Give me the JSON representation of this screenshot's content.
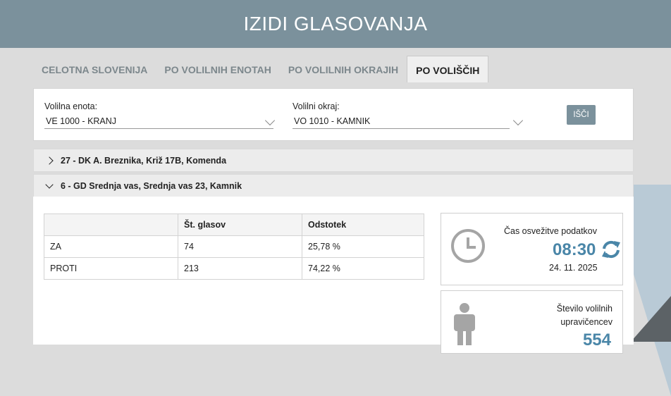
{
  "header": {
    "title": "IZIDI GLASOVANJA"
  },
  "tabs": [
    {
      "label": "CELOTNA SLOVENIJA"
    },
    {
      "label": "PO VOLILNIH ENOTAH"
    },
    {
      "label": "PO VOLILNIH OKRAJIH"
    },
    {
      "label": "PO VOLIŠČIH",
      "active": true
    }
  ],
  "filter": {
    "enota_label": "Volilna enota:",
    "enota_value": "VE 1000 - KRANJ",
    "okraj_label": "Volilni okraj:",
    "okraj_value": "VO 1010 - KAMNIK",
    "search_label": "IŠČI"
  },
  "stations": [
    {
      "title": "27 - DK A. Breznika, Križ 17B, Komenda",
      "expanded": false
    },
    {
      "title": "6 - GD Srednja vas, Srednja vas 23, Kamnik",
      "expanded": true
    }
  ],
  "results": {
    "headers": [
      "",
      "Št. glasov",
      "Odstotek"
    ],
    "rows": [
      [
        "ZA",
        "74",
        "25,78 %"
      ],
      [
        "PROTI",
        "213",
        "74,22 %"
      ]
    ]
  },
  "refresh": {
    "label": "Čas osvežitve podatkov",
    "time": "08:30",
    "date": "24. 11. 2025"
  },
  "voters": {
    "label_line1": "Število volilnih",
    "label_line2": "upravičencev",
    "count": "554"
  },
  "colors": {
    "accent": "#7b919c",
    "number": "#4a86a8"
  }
}
